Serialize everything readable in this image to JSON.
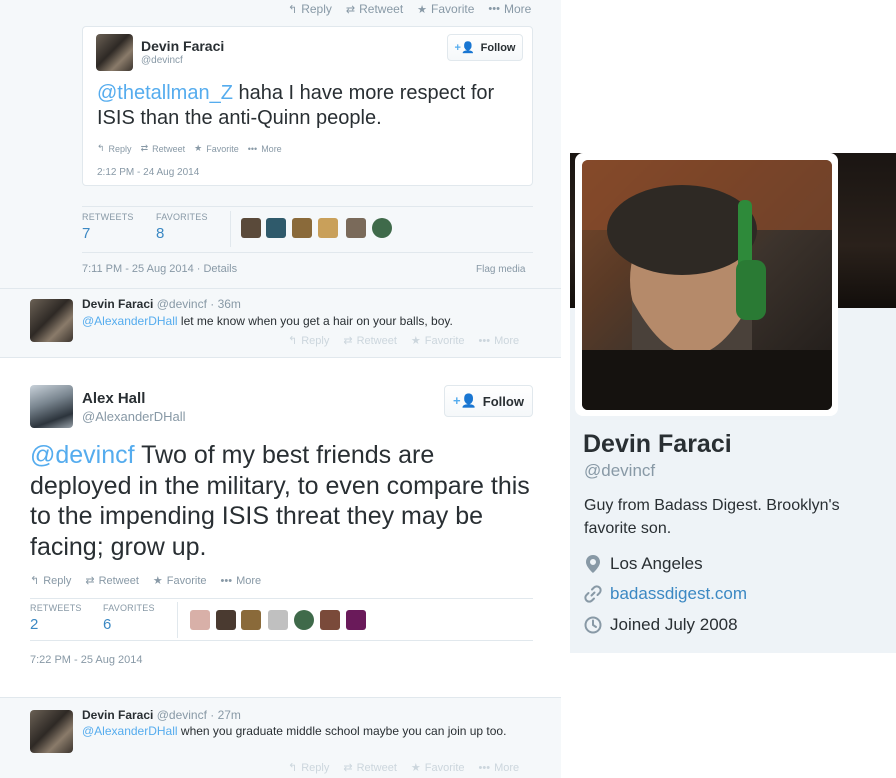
{
  "top_actions": {
    "reply": "Reply",
    "retweet": "Retweet",
    "favorite": "Favorite",
    "more": "More"
  },
  "embedded_tweet": {
    "name": "Devin Faraci",
    "handle": "@devincf",
    "follow_label": "Follow",
    "mention": "@thetallman_Z",
    "text": " haha I have more respect for ISIS than the anti-Quinn people.",
    "actions": {
      "reply": "Reply",
      "retweet": "Retweet",
      "favorite": "Favorite",
      "more": "More"
    },
    "timestamp": "2:12 PM - 24 Aug 2014"
  },
  "quoted_stats": {
    "retweets_label": "RETWEETS",
    "retweets": "7",
    "favorites_label": "FAVORITES",
    "favorites": "8",
    "meta": "7:11 PM - 25 Aug 2014 · Details",
    "flag": "Flag media"
  },
  "reply1": {
    "name": "Devin Faraci",
    "handle_time": "@devincf · 36m",
    "mention": "@AlexanderDHall",
    "text": " let me know when you get a hair on your balls, boy.",
    "actions": {
      "reply": "Reply",
      "retweet": "Retweet",
      "favorite": "Favorite",
      "more": "More"
    }
  },
  "main_tweet": {
    "name": "Alex Hall",
    "handle": "@AlexanderDHall",
    "follow_label": "Follow",
    "mention": "@devincf",
    "text": " Two of my best friends are deployed in the military, to even compare this to the impending ISIS threat they may be facing; grow up.",
    "actions": {
      "reply": "Reply",
      "retweet": "Retweet",
      "favorite": "Favorite",
      "more": "More"
    },
    "retweets_label": "RETWEETS",
    "retweets": "2",
    "favorites_label": "FAVORITES",
    "favorites": "6",
    "timestamp": "7:22 PM - 25 Aug 2014"
  },
  "reply2": {
    "name": "Devin Faraci",
    "handle_time": "@devincf · 27m",
    "mention": "@AlexanderDHall",
    "text": " when you graduate middle school maybe you can join up too.",
    "actions": {
      "reply": "Reply",
      "retweet": "Retweet",
      "favorite": "Favorite",
      "more": "More"
    }
  },
  "profile": {
    "name": "Devin Faraci",
    "handle": "@devincf",
    "bio": "Guy from Badass Digest. Brooklyn's favorite son.",
    "location": "Los Angeles",
    "website": "badassdigest.com",
    "joined": "Joined July 2008"
  },
  "colors": {
    "link": "#3b88c3",
    "mention": "#55acee",
    "muted": "#8899a6",
    "panel": "#f5f8fa",
    "profile_card": "#eef3f7"
  },
  "icons": [
    "reply-icon",
    "retweet-icon",
    "star-icon",
    "more-icon",
    "follow-person-icon",
    "location-pin-icon",
    "link-icon",
    "clock-icon"
  ]
}
